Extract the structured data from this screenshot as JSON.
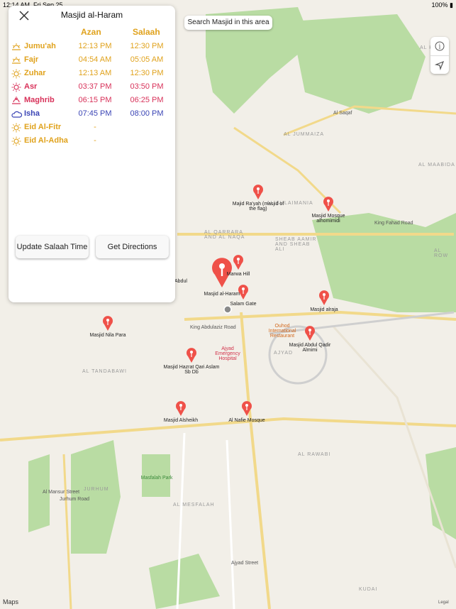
{
  "status": {
    "time": "12:14 AM",
    "date": "Fri Sep 25",
    "battery": "100%"
  },
  "search_area_label": "Search Masjid in this area",
  "panel": {
    "title": "Masjid al-Haram",
    "azan_header": "Azan",
    "salaah_header": "Salaah",
    "prayers": [
      {
        "name": "Jumu'ah",
        "azan": "12:13 PM",
        "salaah": "12:30 PM",
        "color": "#e0a21c",
        "icon": "sunrise-icon"
      },
      {
        "name": "Fajr",
        "azan": "04:54 AM",
        "salaah": "05:05 AM",
        "color": "#e0a21c",
        "icon": "sunrise-icon"
      },
      {
        "name": "Zuhar",
        "azan": "12:13 AM",
        "salaah": "12:30 PM",
        "color": "#e0a21c",
        "icon": "sun-icon"
      },
      {
        "name": "Asr",
        "azan": "03:37 PM",
        "salaah": "03:50 PM",
        "color": "#d8325a",
        "icon": "sun-icon"
      },
      {
        "name": "Maghrib",
        "azan": "06:15 PM",
        "salaah": "06:25 PM",
        "color": "#d8325a",
        "icon": "sunset-icon"
      },
      {
        "name": "Isha",
        "azan": "07:45 PM",
        "salaah": "08:00 PM",
        "color": "#3b45b5",
        "icon": "cloud-moon-icon"
      },
      {
        "name": "Eid Al-Fitr",
        "azan": "-",
        "salaah": "",
        "color": "#e0a21c",
        "icon": "sun-icon"
      },
      {
        "name": "Eid Al-Adha",
        "azan": "-",
        "salaah": "",
        "color": "#e0a21c",
        "icon": "sun-icon"
      }
    ],
    "update_label": "Update Salaah Time",
    "directions_label": "Get Directions"
  },
  "map": {
    "areas": [
      "AL JUMMAIZA",
      "AL MAABIDA",
      "AL SULAIMANIA",
      "AL QARRARA AND AL NAQA",
      "SHEAB AAMIR AND SHEAB ALI",
      "AL ROW",
      "AJYAD",
      "AL TANDABAWI",
      "AL RAWABI",
      "JURHUM",
      "AL MESFALAH",
      "KUDAI",
      "AL KHA"
    ],
    "pins": [
      {
        "label": "Majid Ra'yah (masjid of the flag)"
      },
      {
        "label": "Masjid Mosque alhomimidi"
      },
      {
        "label": "Masjid al-Haram"
      },
      {
        "label": "Salam Gate"
      },
      {
        "label": "Masjid alraja"
      },
      {
        "label": "Masjid Abdul Qadir Almimi"
      },
      {
        "label": "Masjid Nila Para"
      },
      {
        "label": "Masjid Hazrat Qari Aslam Sb Db"
      },
      {
        "label": "Masjid Alsheikh"
      },
      {
        "label": "Al Nafie Mosque"
      },
      {
        "label": "Marwa Hill"
      }
    ],
    "pois": [
      "Ouhod International Restaurant",
      "Ajyad Emergency Hospital",
      "Masfalah Park",
      "Abdul"
    ],
    "roads": [
      "King Fahad Road",
      "King Abdulaziz Road",
      "Ajyad Street",
      "Al Mansur Street",
      "Jurhum Road",
      "Al Saqaf"
    ],
    "legal": "Legal",
    "maps_label": "Maps"
  }
}
